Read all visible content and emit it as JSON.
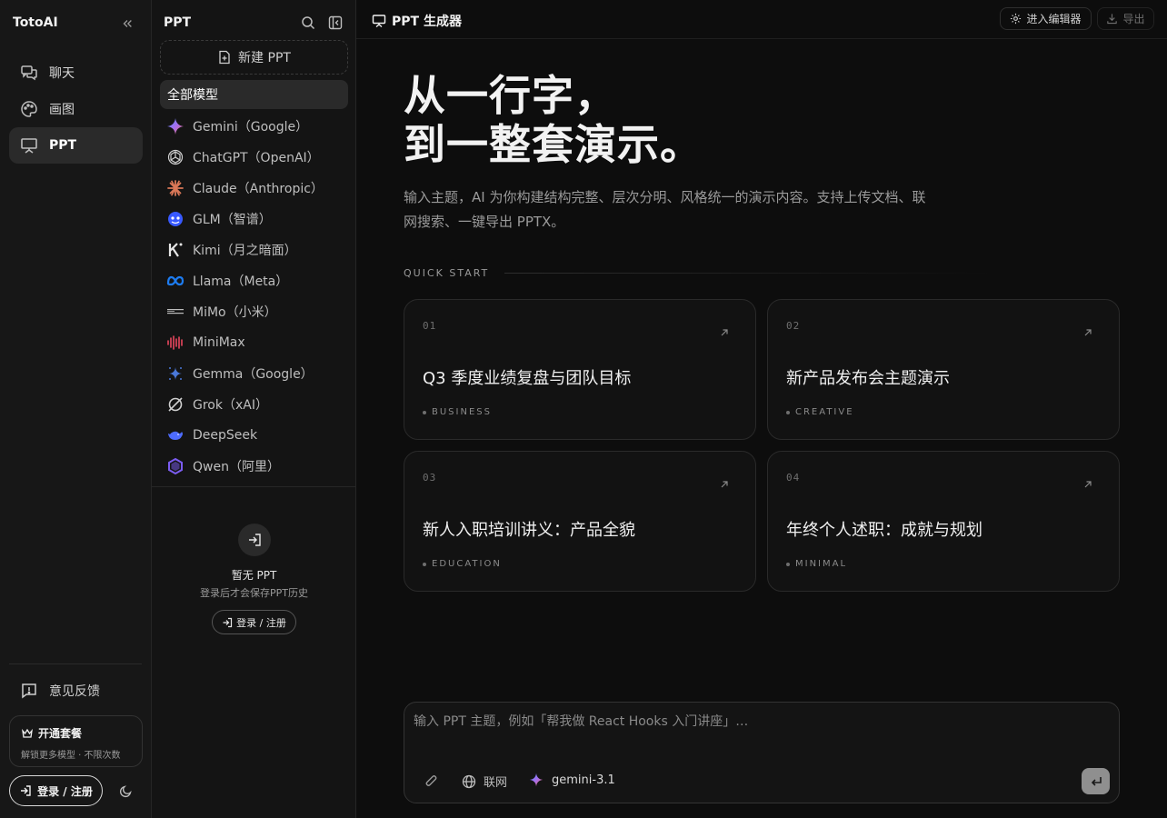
{
  "app": {
    "brand": "TotoAI"
  },
  "rail": {
    "items": [
      {
        "label": "聊天",
        "icon": "chat-bubbles-icon"
      },
      {
        "label": "画图",
        "icon": "palette-icon"
      },
      {
        "label": "PPT",
        "icon": "presentation-icon",
        "active": true
      }
    ],
    "feedback_label": "意见反馈",
    "plan": {
      "title": "开通套餐",
      "subtitle": "解锁更多模型 · 不限次数"
    },
    "login_label": "登录 / 注册"
  },
  "panel": {
    "title": "PPT",
    "new_label": "新建 PPT",
    "all_models_label": "全部模型",
    "models": [
      {
        "label": "Gemini（Google）",
        "icon": "gemini-icon"
      },
      {
        "label": "ChatGPT（OpenAI）",
        "icon": "openai-icon"
      },
      {
        "label": "Claude（Anthropic）",
        "icon": "claude-icon"
      },
      {
        "label": "GLM（智谱）",
        "icon": "glm-icon"
      },
      {
        "label": "Kimi（月之暗面）",
        "icon": "kimi-icon"
      },
      {
        "label": "Llama（Meta）",
        "icon": "meta-icon"
      },
      {
        "label": "MiMo（小米）",
        "icon": "mimo-icon"
      },
      {
        "label": "MiniMax",
        "icon": "minimax-icon"
      },
      {
        "label": "Gemma（Google）",
        "icon": "gemma-icon"
      },
      {
        "label": "Grok（xAI）",
        "icon": "grok-icon"
      },
      {
        "label": "DeepSeek",
        "icon": "deepseek-icon"
      },
      {
        "label": "Qwen（阿里）",
        "icon": "qwen-icon"
      }
    ],
    "empty": {
      "title": "暂无 PPT",
      "subtitle": "登录后才会保存PPT历史",
      "login_label": "登录 / 注册"
    }
  },
  "main": {
    "topbar": {
      "title": "PPT 生成器",
      "editor_label": "进入编辑器",
      "export_label": "导出"
    },
    "hero": {
      "line1": "从一行字，",
      "line2": "到一整套演示。"
    },
    "description": "输入主题，AI 为你构建结构完整、层次分明、风格统一的演示内容。支持上传文档、联网搜索、一键导出 PPTX。",
    "quick_start_label": "QUICK START",
    "cards": [
      {
        "num": "01",
        "title": "Q3 季度业绩复盘与团队目标",
        "tag": "BUSINESS"
      },
      {
        "num": "02",
        "title": "新产品发布会主题演示",
        "tag": "CREATIVE"
      },
      {
        "num": "03",
        "title": "新人入职培训讲义：产品全貌",
        "tag": "EDUCATION"
      },
      {
        "num": "04",
        "title": "年终个人述职：成就与规划",
        "tag": "MINIMAL"
      }
    ],
    "composer": {
      "placeholder": "输入 PPT 主题，例如「帮我做 React Hooks 入门讲座」…",
      "web_label": "联网",
      "model_label": "gemini-3.1"
    }
  },
  "colors": {
    "background": "#0d0d0d",
    "rail": "#171717",
    "panel": "#141414",
    "active": "#2a2a2a",
    "text": "#e6e6e6",
    "muted": "#9a9a9a"
  }
}
